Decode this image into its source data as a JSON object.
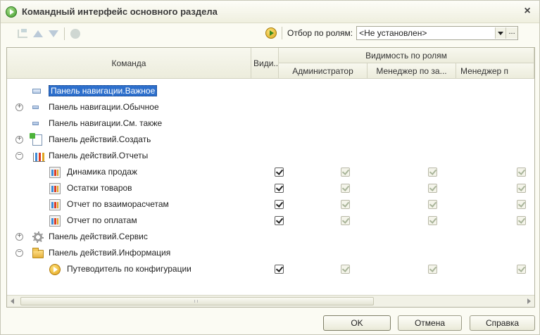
{
  "window": {
    "title": "Командный интерфейс основного раздела",
    "close_label": "×"
  },
  "toolbar": {
    "role_filter_label": "Отбор по ролям:",
    "role_filter_value": "<Не установлен>",
    "more_label": "..."
  },
  "columns": {
    "command": "Команда",
    "visibility": "Види...",
    "visibility_by_roles": "Видимость по ролям",
    "roles": [
      "Администратор",
      "Менеджер по за...",
      "Менеджер п"
    ]
  },
  "rows": [
    {
      "label": "Панель навигации.Важное",
      "expander": "",
      "icon": "nav-important-icon",
      "selected": true
    },
    {
      "label": "Панель навигации.Обычное",
      "expander": "⊕",
      "icon": "nav-normal-icon"
    },
    {
      "label": "Панель навигации.См. также",
      "expander": "",
      "icon": "nav-see-also-icon"
    },
    {
      "label": "Панель действий.Создать",
      "expander": "⊕",
      "icon": "create-document-icon"
    },
    {
      "label": "Панель действий.Отчеты",
      "expander": "⊖",
      "icon": "reports-chart-icon"
    },
    {
      "label": "Динамика продаж",
      "icon": "report-icon",
      "visible": true,
      "roles": [
        true,
        true,
        true
      ]
    },
    {
      "label": "Остатки товаров",
      "icon": "report-icon",
      "visible": true,
      "roles": [
        true,
        true,
        true
      ]
    },
    {
      "label": "Отчет по взаиморасчетам",
      "icon": "report-icon",
      "visible": true,
      "roles": [
        true,
        true,
        true
      ]
    },
    {
      "label": "Отчет по оплатам",
      "icon": "report-icon",
      "visible": true,
      "roles": [
        true,
        true,
        true
      ]
    },
    {
      "label": "Панель действий.Сервис",
      "expander": "⊕",
      "icon": "gear-icon"
    },
    {
      "label": "Панель действий.Информация",
      "expander": "⊖",
      "icon": "folder-icon"
    },
    {
      "label": "Путеводитель по конфигурации",
      "icon": "play-icon",
      "visible": true,
      "roles": [
        true,
        true,
        true
      ]
    }
  ],
  "buttons": {
    "ok": "OK",
    "cancel": "Отмена",
    "help": "Справка"
  }
}
